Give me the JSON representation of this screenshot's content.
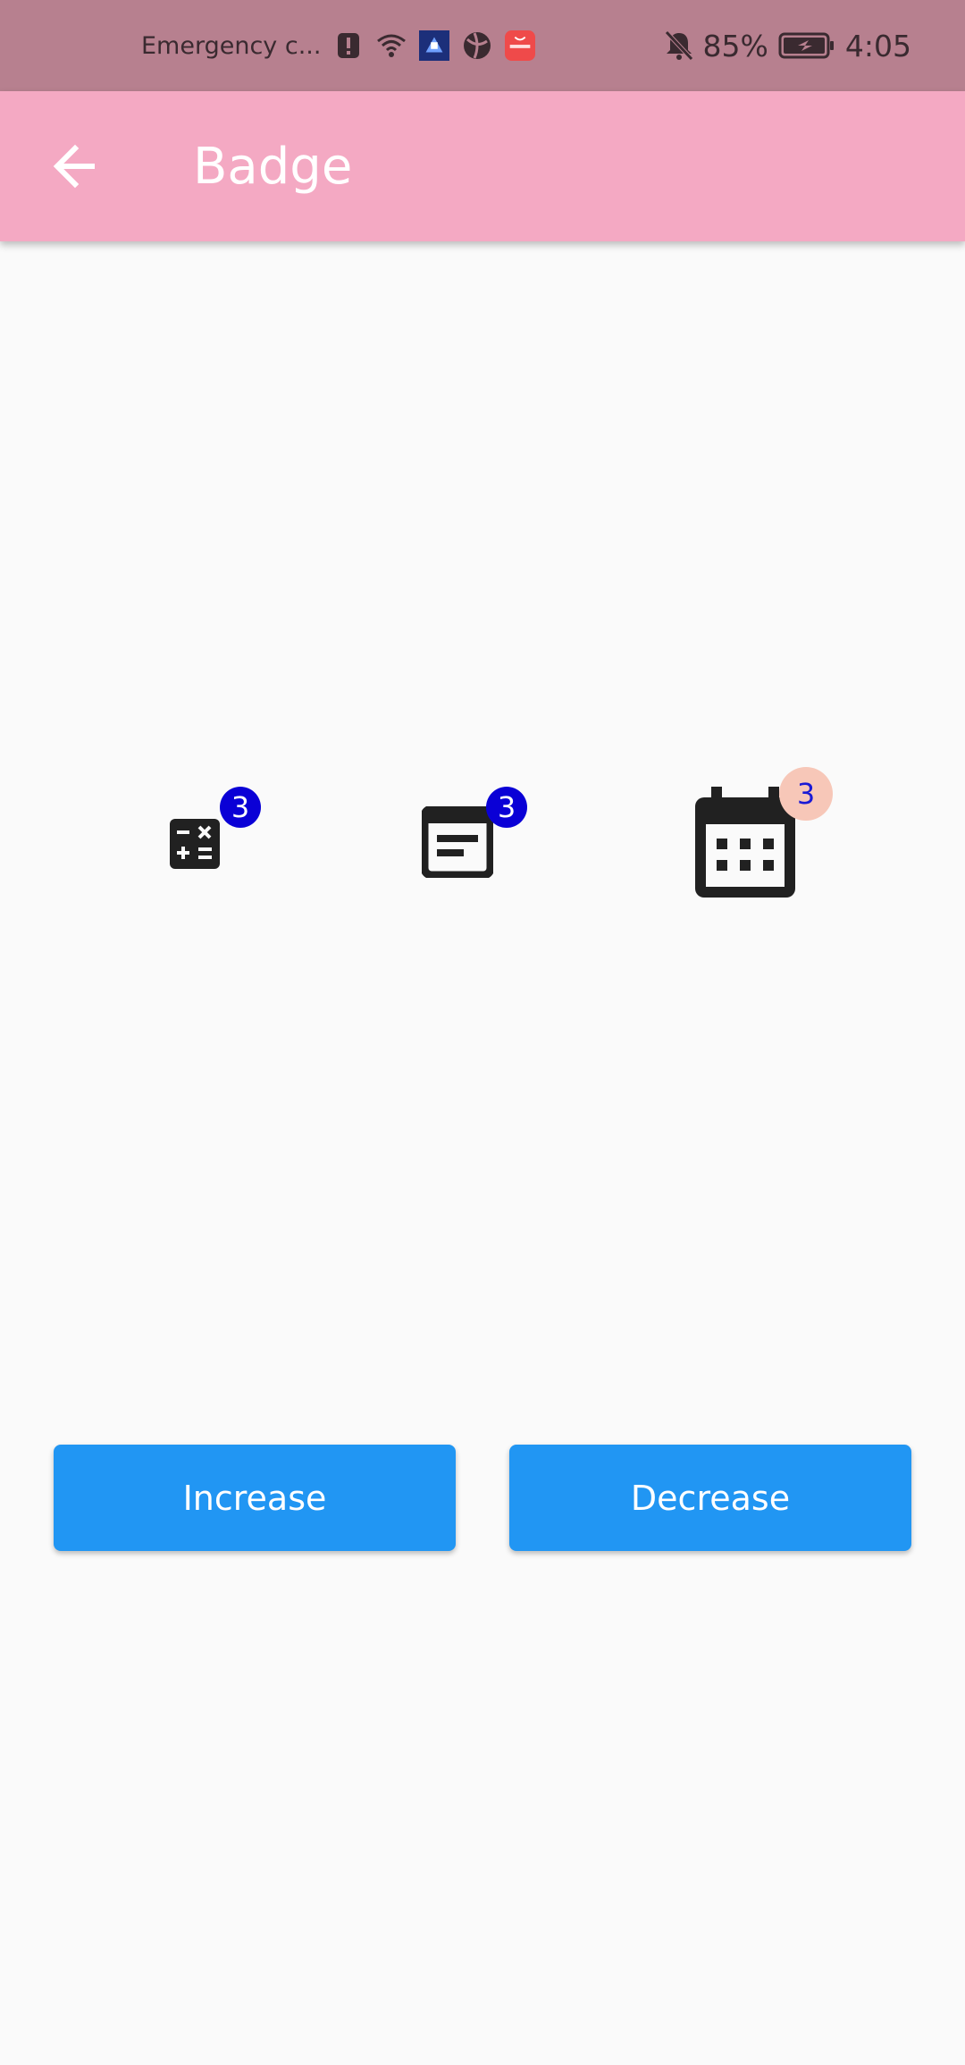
{
  "status_bar": {
    "carrier_text": "Emergency c...",
    "battery_percent": "85%",
    "time": "4:05"
  },
  "app_bar": {
    "title": "Badge"
  },
  "badges": {
    "calculator": {
      "count": "3",
      "badge_color": "#0a00d6",
      "text_color": "#ffffff"
    },
    "article": {
      "count": "3",
      "badge_color": "#0a00d6",
      "text_color": "#ffffff"
    },
    "calendar": {
      "count": "3",
      "badge_color": "#f7c7b8",
      "text_color": "#1a1ad6"
    }
  },
  "buttons": {
    "increase_label": "Increase",
    "decrease_label": "Decrease"
  },
  "colors": {
    "status_bar": "#b7808f",
    "app_bar": "#f4a9c3",
    "button": "#2196f3",
    "background": "#fafafa"
  }
}
